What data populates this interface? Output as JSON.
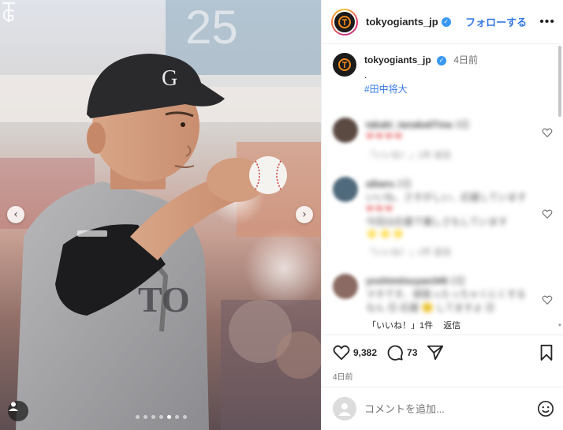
{
  "post": {
    "username": "tokyogiants_jp",
    "follow_label": "フォローする",
    "more_label": "•••",
    "verified_mark": "✓",
    "caption": {
      "username": "tokyogiants_jp",
      "time": "4日前",
      "text": ".",
      "hashtag": "#田中将大"
    },
    "comments": [
      {
        "name": "takaki_tanaka07ma",
        "time": "3日",
        "lines": [
          "❤❤❤❤"
        ],
        "meta": "「いいね！」1件  返信"
      },
      {
        "name": "aibaru",
        "time": "2日",
        "lines": [
          "いいね、さすがしい、応援しています",
          "❤❤❤",
          "今回は応援で優しさもしています",
          "⭐⭐⭐"
        ],
        "meta": "「いいね！」1件  返信"
      },
      {
        "name": "yoshimitsuyan345",
        "time": "2日",
        "lines": [
          "マネです、頑張ったっちゃくにくする",
          "なん 😊 応援 🙂 してますよ 😊"
        ],
        "meta": ""
      }
    ],
    "visible_reply": {
      "likes": "「いいね！」1件",
      "reply": "返信"
    },
    "likes_count": "9,382",
    "comments_count": "73",
    "date": "4日前",
    "comment_placeholder": "コメントを追加..."
  },
  "carousel": {
    "total": 7,
    "active_index": 4
  },
  "colors": {
    "accent": "#3578e5",
    "verified": "#3897f0",
    "text": "#262626",
    "muted": "#737373"
  },
  "icons": {
    "prev": "chevron-left-icon",
    "next": "chevron-right-icon",
    "tag": "user-tag-icon",
    "like": "heart-icon",
    "comment": "comment-icon",
    "share": "send-icon",
    "save": "bookmark-icon",
    "emoji": "emoji-icon",
    "more": "more-icon"
  }
}
